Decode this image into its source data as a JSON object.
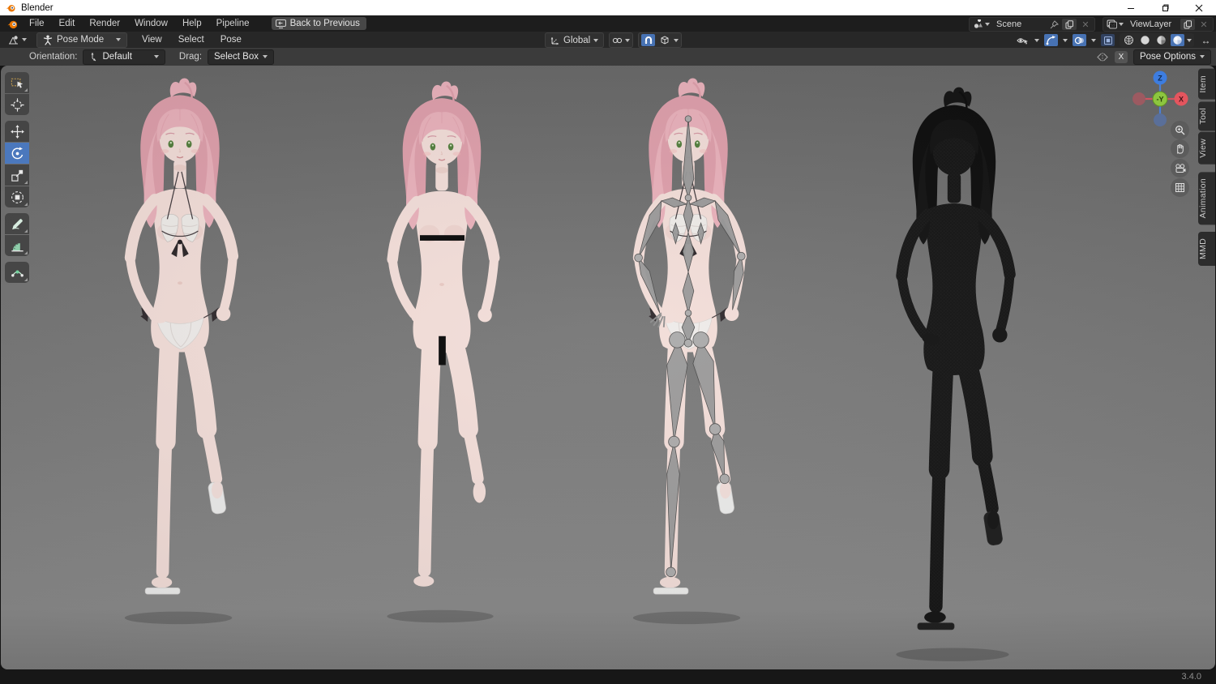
{
  "window": {
    "title": "Blender"
  },
  "topbar": {
    "menus": [
      "File",
      "Edit",
      "Render",
      "Window",
      "Help",
      "Pipeline"
    ],
    "back_button": "Back to Previous",
    "scene_value": "Scene",
    "view_layer_value": "ViewLayer"
  },
  "viewport_header": {
    "mode": "Pose Mode",
    "menus": [
      "View",
      "Select",
      "Pose"
    ],
    "transform_orientation": "Global"
  },
  "tool_settings": {
    "orientation_label": "Orientation:",
    "orientation_value": "Default",
    "drag_label": "Drag:",
    "drag_value": "Select Box",
    "x_axis_label": "X",
    "pose_options_label": "Pose Options"
  },
  "toolbar": {
    "tools": [
      {
        "name": "tweak-select",
        "active": false
      },
      {
        "name": "cursor",
        "active": false
      },
      {
        "name": "move",
        "active": false
      },
      {
        "name": "rotate",
        "active": true
      },
      {
        "name": "scale",
        "active": false
      },
      {
        "name": "transform",
        "active": false
      },
      {
        "name": "annotate",
        "active": false
      },
      {
        "name": "measure",
        "active": false
      },
      {
        "name": "pose-breakdowner",
        "active": false
      }
    ]
  },
  "sidebar_tabs": [
    "Item",
    "Tool",
    "View",
    "Animation",
    "MMD"
  ],
  "nav_gizmo": {
    "z_label": "Z",
    "x_label": "X",
    "y_label": "-Y"
  },
  "viewport": {
    "figures": [
      {
        "variant": "shaded-bikini"
      },
      {
        "variant": "shaded-censored"
      },
      {
        "variant": "armature-overlay"
      },
      {
        "variant": "wireframe-dark"
      }
    ]
  },
  "status_bar": {
    "version": "3.4.0"
  },
  "colors": {
    "accent_blue": "#4772b3",
    "axis_x_red": "#e4555e",
    "axis_y_green": "#7fb43e",
    "axis_z_blue": "#3d7de0",
    "viewport_gray": "#7a7a7a",
    "titlebar_bg": "#ffffff",
    "skin_tone": "#f3ded9",
    "hair_pink": "#e7a9b4"
  }
}
